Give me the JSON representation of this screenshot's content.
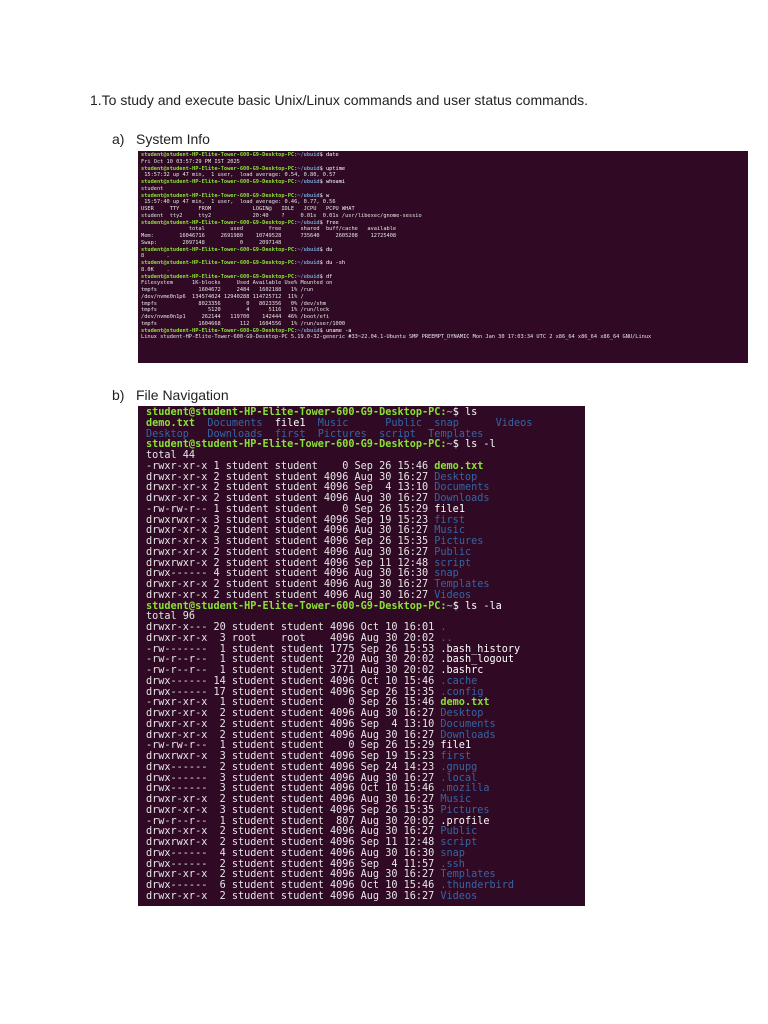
{
  "heading": "1.To study and execute basic Unix/Linux commands and user status commands.",
  "section_a": {
    "label": "a)",
    "title": "System Info"
  },
  "section_b": {
    "label": "b)",
    "title": "File Navigation"
  },
  "colors": {
    "terminal_bg": "#300a24",
    "prompt": "#8ae234",
    "path": "#729fcf",
    "dir": "#3465a4"
  },
  "terminal1": {
    "prompt_user": "student@student-HP-Elite-Tower-600-G9-Desktop-PC:",
    "path": "~/ubuid",
    "lines": [
      {
        "t": "cmd",
        "c": "date"
      },
      {
        "t": "out",
        "c": "Fri Oct 10 03:57:29 PM IST 2025"
      },
      {
        "t": "cmd",
        "c": "uptime"
      },
      {
        "t": "out",
        "c": " 15:57:32 up 47 min,  1 user,  load average: 0.54, 0.80, 0.57"
      },
      {
        "t": "cmd",
        "c": "whoami"
      },
      {
        "t": "out",
        "c": "student"
      },
      {
        "t": "cmd",
        "c": "w"
      },
      {
        "t": "out",
        "c": " 15:57:40 up 47 min,  1 user,  load average: 0.46, 0.77, 0.56"
      },
      {
        "t": "out",
        "c": "USER     TTY      FROM             LOGIN@   IDLE   JCPU   PCPU WHAT"
      },
      {
        "t": "out",
        "c": "student  tty2     tty2             20:40    ?     0.01s  0.01s /usr/libexec/gnome-sessio"
      },
      {
        "t": "cmd",
        "c": "free"
      },
      {
        "t": "out",
        "c": "               total        used        free      shared  buff/cache   available"
      },
      {
        "t": "out",
        "c": "Mem:        16046716     2691980    10749528      735640     2605208    12725408"
      },
      {
        "t": "out",
        "c": "Swap:        2097148           0     2097148"
      },
      {
        "t": "cmd",
        "c": "du"
      },
      {
        "t": "out",
        "c": "8       ."
      },
      {
        "t": "cmd",
        "c": "du -sh"
      },
      {
        "t": "out",
        "c": "8.0K    ."
      },
      {
        "t": "cmd",
        "c": "df"
      },
      {
        "t": "out",
        "c": "Filesystem      1K-blocks     Used Available Use% Mounted on"
      },
      {
        "t": "out",
        "c": "tmpfs             1604672     2484   1602188   1% /run"
      },
      {
        "t": "out",
        "c": "/dev/nvme0n1p6  134574024 12940288 114725712  11% /"
      },
      {
        "t": "out",
        "c": "tmpfs             8023356        0   8023356   0% /dev/shm"
      },
      {
        "t": "out",
        "c": "tmpfs                5120        4      5116   1% /run/lock"
      },
      {
        "t": "out",
        "c": "/dev/nvme0n1p1     262144   119700    142444  46% /boot/efi"
      },
      {
        "t": "out",
        "c": "tmpfs             1604668      112   1604556   1% /run/user/1000"
      },
      {
        "t": "cmd",
        "c": "uname -a"
      },
      {
        "t": "out",
        "c": "Linux student-HP-Elite-Tower-600-G9-Desktop-PC 5.19.0-32-generic #33~22.04.1-Ubuntu SMP PREEMPT_DYNAMIC Mon Jan 30 17:03:34 UTC 2 x86_64 x86_64 x86_64 GNU/Linux"
      }
    ]
  },
  "terminal2": {
    "prompt_user": "student@student-HP-Elite-Tower-600-G9-Desktop-PC:",
    "path": "~",
    "lines": [
      {
        "t": "cmd",
        "c": "ls"
      },
      {
        "t": "seg",
        "s": [
          [
            "exe",
            "demo.txt  "
          ],
          [
            "dir",
            "Documents  "
          ],
          [
            "file",
            "file1  "
          ],
          [
            "dir",
            "Music      "
          ],
          [
            "dir",
            "Public  "
          ],
          [
            "dir",
            "snap      "
          ],
          [
            "dir",
            "Videos"
          ]
        ]
      },
      {
        "t": "seg",
        "s": [
          [
            "dir",
            "Desktop   "
          ],
          [
            "dir",
            "Downloads  "
          ],
          [
            "dir",
            "first  "
          ],
          [
            "dir",
            "Pictures  "
          ],
          [
            "dir",
            "script  "
          ],
          [
            "dir",
            "Templates"
          ]
        ]
      },
      {
        "t": "cmd",
        "c": "ls -l"
      },
      {
        "t": "out",
        "c": "total 44"
      },
      {
        "t": "ls",
        "p": "-rwxr-xr-x 1 student student    0 Sep 26 15:46 ",
        "n": "demo.txt",
        "k": "exe"
      },
      {
        "t": "ls",
        "p": "drwxr-xr-x 2 student student 4096 Aug 30 16:27 ",
        "n": "Desktop",
        "k": "dir"
      },
      {
        "t": "ls",
        "p": "drwxr-xr-x 2 student student 4096 Sep  4 13:10 ",
        "n": "Documents",
        "k": "dir"
      },
      {
        "t": "ls",
        "p": "drwxr-xr-x 2 student student 4096 Aug 30 16:27 ",
        "n": "Downloads",
        "k": "dir"
      },
      {
        "t": "ls",
        "p": "-rw-rw-r-- 1 student student    0 Sep 26 15:29 ",
        "n": "file1",
        "k": "file"
      },
      {
        "t": "ls",
        "p": "drwxrwxr-x 3 student student 4096 Sep 19 15:23 ",
        "n": "first",
        "k": "dir"
      },
      {
        "t": "ls",
        "p": "drwxr-xr-x 2 student student 4096 Aug 30 16:27 ",
        "n": "Music",
        "k": "dir"
      },
      {
        "t": "ls",
        "p": "drwxr-xr-x 3 student student 4096 Sep 26 15:35 ",
        "n": "Pictures",
        "k": "dir"
      },
      {
        "t": "ls",
        "p": "drwxr-xr-x 2 student student 4096 Aug 30 16:27 ",
        "n": "Public",
        "k": "dir"
      },
      {
        "t": "ls",
        "p": "drwxrwxr-x 2 student student 4096 Sep 11 12:48 ",
        "n": "script",
        "k": "dir"
      },
      {
        "t": "ls",
        "p": "drwx------ 4 student student 4096 Aug 30 16:30 ",
        "n": "snap",
        "k": "dir"
      },
      {
        "t": "ls",
        "p": "drwxr-xr-x 2 student student 4096 Aug 30 16:27 ",
        "n": "Templates",
        "k": "dir"
      },
      {
        "t": "ls",
        "p": "drwxr-xr-x 2 student student 4096 Aug 30 16:27 ",
        "n": "Videos",
        "k": "dir"
      },
      {
        "t": "cmd",
        "c": "ls -la"
      },
      {
        "t": "out",
        "c": "total 96"
      },
      {
        "t": "ls",
        "p": "drwxr-x--- 20 student student 4096 Oct 10 16:01 ",
        "n": ".",
        "k": "dir"
      },
      {
        "t": "ls",
        "p": "drwxr-xr-x  3 root    root    4096 Aug 30 20:02 ",
        "n": "..",
        "k": "dir"
      },
      {
        "t": "ls",
        "p": "-rw-------  1 student student 1775 Sep 26 15:53 ",
        "n": ".bash_history",
        "k": "file"
      },
      {
        "t": "ls",
        "p": "-rw-r--r--  1 student student  220 Aug 30 20:02 ",
        "n": ".bash_logout",
        "k": "file"
      },
      {
        "t": "ls",
        "p": "-rw-r--r--  1 student student 3771 Aug 30 20:02 ",
        "n": ".bashrc",
        "k": "file"
      },
      {
        "t": "ls",
        "p": "drwx------ 14 student student 4096 Oct 10 15:46 ",
        "n": ".cache",
        "k": "dir"
      },
      {
        "t": "ls",
        "p": "drwx------ 17 student student 4096 Sep 26 15:35 ",
        "n": ".config",
        "k": "dir"
      },
      {
        "t": "ls",
        "p": "-rwxr-xr-x  1 student student    0 Sep 26 15:46 ",
        "n": "demo.txt",
        "k": "exe"
      },
      {
        "t": "ls",
        "p": "drwxr-xr-x  2 student student 4096 Aug 30 16:27 ",
        "n": "Desktop",
        "k": "dir"
      },
      {
        "t": "ls",
        "p": "drwxr-xr-x  2 student student 4096 Sep  4 13:10 ",
        "n": "Documents",
        "k": "dir"
      },
      {
        "t": "ls",
        "p": "drwxr-xr-x  2 student student 4096 Aug 30 16:27 ",
        "n": "Downloads",
        "k": "dir"
      },
      {
        "t": "ls",
        "p": "-rw-rw-r--  1 student student    0 Sep 26 15:29 ",
        "n": "file1",
        "k": "file"
      },
      {
        "t": "ls",
        "p": "drwxrwxr-x  3 student student 4096 Sep 19 15:23 ",
        "n": "first",
        "k": "dir"
      },
      {
        "t": "ls",
        "p": "drwx------  2 student student 4096 Sep 24 14:23 ",
        "n": ".gnupg",
        "k": "dir"
      },
      {
        "t": "ls",
        "p": "drwx------  3 student student 4096 Aug 30 16:27 ",
        "n": ".local",
        "k": "dir"
      },
      {
        "t": "ls",
        "p": "drwx------  3 student student 4096 Oct 10 15:46 ",
        "n": ".mozilla",
        "k": "dir"
      },
      {
        "t": "ls",
        "p": "drwxr-xr-x  2 student student 4096 Aug 30 16:27 ",
        "n": "Music",
        "k": "dir"
      },
      {
        "t": "ls",
        "p": "drwxr-xr-x  3 student student 4096 Sep 26 15:35 ",
        "n": "Pictures",
        "k": "dir"
      },
      {
        "t": "ls",
        "p": "-rw-r--r--  1 student student  807 Aug 30 20:02 ",
        "n": ".profile",
        "k": "file"
      },
      {
        "t": "ls",
        "p": "drwxr-xr-x  2 student student 4096 Aug 30 16:27 ",
        "n": "Public",
        "k": "dir"
      },
      {
        "t": "ls",
        "p": "drwxrwxr-x  2 student student 4096 Sep 11 12:48 ",
        "n": "script",
        "k": "dir"
      },
      {
        "t": "ls",
        "p": "drwx------  4 student student 4096 Aug 30 16:30 ",
        "n": "snap",
        "k": "dir"
      },
      {
        "t": "ls",
        "p": "drwx------  2 student student 4096 Sep  4 11:57 ",
        "n": ".ssh",
        "k": "dir"
      },
      {
        "t": "ls",
        "p": "drwxr-xr-x  2 student student 4096 Aug 30 16:27 ",
        "n": "Templates",
        "k": "dir"
      },
      {
        "t": "ls",
        "p": "drwx------  6 student student 4096 Oct 10 15:46 ",
        "n": ".thunderbird",
        "k": "dir"
      },
      {
        "t": "ls",
        "p": "drwxr-xr-x  2 student student 4096 Aug 30 16:27 ",
        "n": "Videos",
        "k": "dir"
      }
    ]
  }
}
